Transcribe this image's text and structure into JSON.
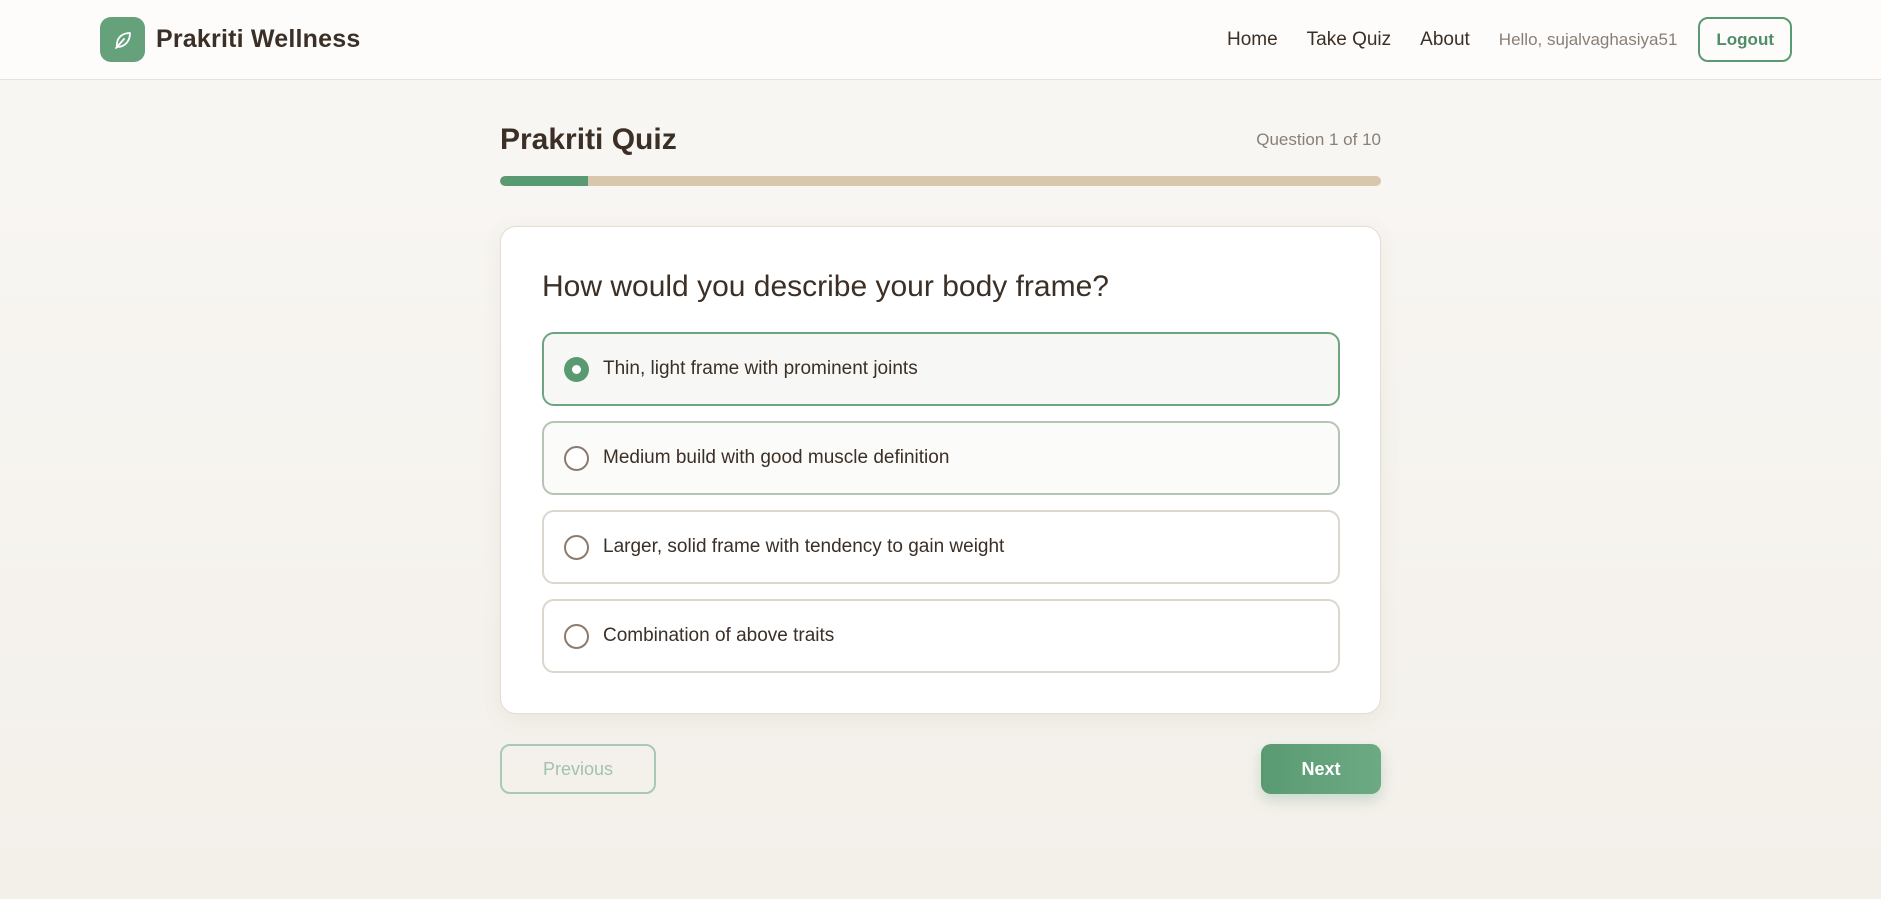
{
  "header": {
    "brand_name": "Prakriti Wellness",
    "brand_icon": "leaf-icon",
    "nav": [
      {
        "label": "Home"
      },
      {
        "label": "Take Quiz"
      },
      {
        "label": "About"
      }
    ],
    "greeting": "Hello, sujalvaghasiya51",
    "logout_label": "Logout"
  },
  "quiz": {
    "title": "Prakriti Quiz",
    "counter": "Question 1 of 10",
    "current_question": 1,
    "total_questions": 10,
    "progress_fraction": 0.1,
    "question": "How would you describe your body frame?",
    "options": [
      {
        "label": "Thin, light frame with prominent joints",
        "selected": true
      },
      {
        "label": "Medium build with good muscle definition",
        "selected": false
      },
      {
        "label": "Larger, solid frame with tendency to gain weight",
        "selected": false
      },
      {
        "label": "Combination of above traits",
        "selected": false
      }
    ],
    "previous_label": "Previous",
    "next_label": "Next"
  },
  "colors": {
    "accent": "#5a9a73",
    "progress_track": "#d9c7ad",
    "text_primary": "#3b2f26",
    "text_muted": "#8a7f76"
  }
}
